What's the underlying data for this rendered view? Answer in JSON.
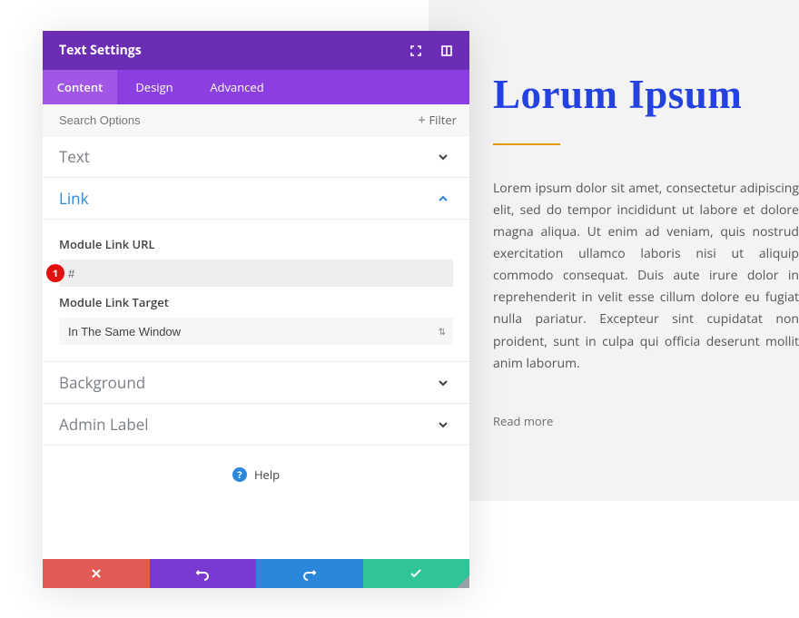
{
  "panel": {
    "title": "Text Settings",
    "tabs": {
      "content": "Content",
      "design": "Design",
      "advanced": "Advanced"
    },
    "search": {
      "placeholder": "Search Options",
      "filter_label": "Filter"
    },
    "sections": {
      "text": "Text",
      "link": "Link",
      "background": "Background",
      "admin_label": "Admin Label"
    },
    "link": {
      "url_label": "Module Link URL",
      "url_value": "#",
      "target_label": "Module Link Target",
      "target_value": "In The Same Window"
    },
    "badge": "1",
    "help_label": "Help"
  },
  "preview": {
    "title": "Lorum Ipsum",
    "body": "Lorem ipsum dolor sit amet, consectetur adipiscing elit, sed do tempor incididunt ut labore et dolore magna aliqua. Ut enim ad veniam, quis nostrud exercitation ullamco laboris nisi ut aliquip commodo consequat. Duis aute irure dolor in reprehenderit in velit esse cillum dolore eu fugiat nulla pariatur. Excepteur sint cupidatat non proident, sunt in culpa qui officia deserunt mollit anim laborum.",
    "read_more": "Read more"
  }
}
